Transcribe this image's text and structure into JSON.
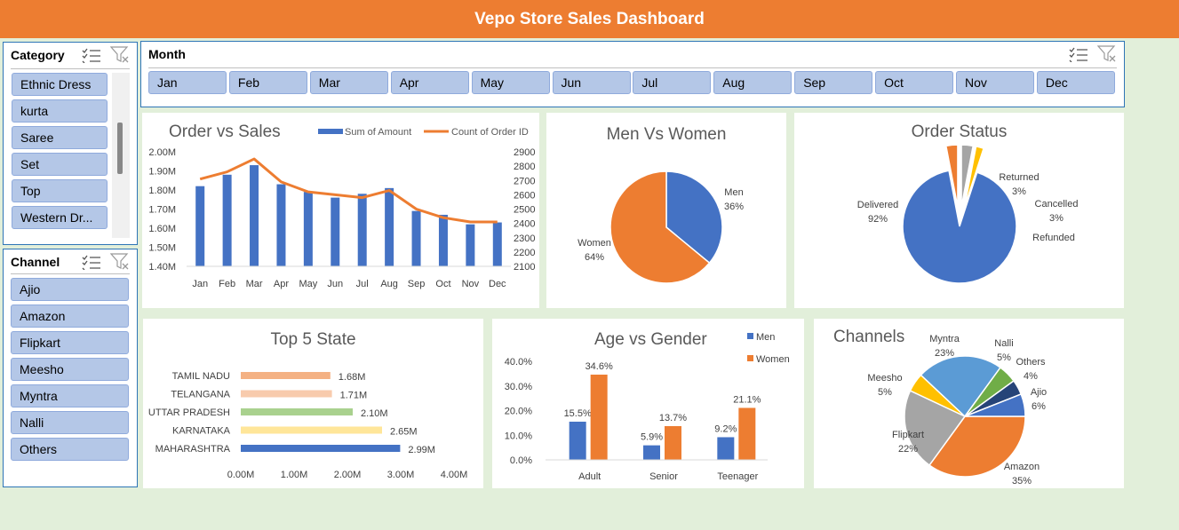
{
  "header": {
    "title": "Vepo Store Sales Dashboard"
  },
  "category_slicer": {
    "title": "Category",
    "items": [
      "Ethnic Dress",
      "kurta",
      "Saree",
      "Set",
      "Top",
      "Western Dr..."
    ]
  },
  "channel_slicer": {
    "title": "Channel",
    "items": [
      "Ajio",
      "Amazon",
      "Flipkart",
      "Meesho",
      "Myntra",
      "Nalli",
      "Others"
    ]
  },
  "month_slicer": {
    "title": "Month",
    "items": [
      "Jan",
      "Feb",
      "Mar",
      "Apr",
      "May",
      "Jun",
      "Jul",
      "Aug",
      "Sep",
      "Oct",
      "Nov",
      "Dec"
    ]
  },
  "colors": {
    "blue": "#4472c4",
    "orange": "#ed7d31",
    "gray": "#a5a5a5",
    "yellow": "#ffc000",
    "light_blue": "#5b9bd5",
    "green": "#70ad47",
    "navy": "#264478"
  },
  "chart_data": [
    {
      "id": "order_vs_sales",
      "type": "bar",
      "title": "Order vs Sales",
      "categories": [
        "Jan",
        "Feb",
        "Mar",
        "Apr",
        "May",
        "Jun",
        "Jul",
        "Aug",
        "Sep",
        "Oct",
        "Nov",
        "Dec"
      ],
      "series": [
        {
          "name": "Sum of Amount",
          "type": "bar",
          "axis": "left",
          "values": [
            1.82,
            1.88,
            1.93,
            1.83,
            1.79,
            1.76,
            1.78,
            1.81,
            1.69,
            1.67,
            1.62,
            1.63
          ]
        },
        {
          "name": "Count of Order ID",
          "type": "line",
          "axis": "right",
          "values": [
            2710,
            2760,
            2850,
            2690,
            2620,
            2600,
            2580,
            2630,
            2500,
            2440,
            2410,
            2410
          ]
        }
      ],
      "ylim": [
        1.4,
        2.0
      ],
      "y_ticks": [
        "1.40M",
        "1.50M",
        "1.60M",
        "1.70M",
        "1.80M",
        "1.90M",
        "2.00M"
      ],
      "y2lim": [
        2100,
        2900
      ],
      "y2_ticks": [
        "2100",
        "2200",
        "2300",
        "2400",
        "2500",
        "2600",
        "2700",
        "2800",
        "2900"
      ],
      "legend": "top"
    },
    {
      "id": "men_vs_women",
      "type": "pie",
      "title": "Men Vs Women",
      "labels": [
        "Men",
        "Women"
      ],
      "values": [
        36,
        64
      ],
      "value_labels": [
        "36%",
        "64%"
      ]
    },
    {
      "id": "order_status",
      "type": "pie",
      "title": "Order Status",
      "labels": [
        "Delivered",
        "Returned",
        "Cancelled",
        "Refunded"
      ],
      "values": [
        92,
        3,
        3,
        2
      ],
      "value_labels": [
        "92%",
        "3%",
        "3%",
        ""
      ]
    },
    {
      "id": "top5_state",
      "type": "bar",
      "orientation": "horizontal",
      "title": "Top 5 State",
      "categories": [
        "TAMIL NADU",
        "TELANGANA",
        "UTTAR PRADESH",
        "KARNATAKA",
        "MAHARASHTRA"
      ],
      "values": [
        1.68,
        1.71,
        2.1,
        2.65,
        2.99
      ],
      "value_labels": [
        "1.68M",
        "1.71M",
        "2.10M",
        "2.65M",
        "2.99M"
      ],
      "xlim": [
        0,
        4
      ],
      "x_ticks": [
        "0.00M",
        "1.00M",
        "2.00M",
        "3.00M",
        "4.00M"
      ]
    },
    {
      "id": "age_vs_gender",
      "type": "bar",
      "title": "Age vs Gender",
      "categories": [
        "Adult",
        "Senior",
        "Teenager"
      ],
      "series": [
        {
          "name": "Men",
          "values": [
            15.5,
            5.9,
            9.2
          ],
          "value_labels": [
            "15.5%",
            "5.9%",
            "9.2%"
          ]
        },
        {
          "name": "Women",
          "values": [
            34.6,
            13.7,
            21.1
          ],
          "value_labels": [
            "34.6%",
            "13.7%",
            "21.1%"
          ]
        }
      ],
      "ylim": [
        0,
        40
      ],
      "y_ticks": [
        "0.0%",
        "10.0%",
        "20.0%",
        "30.0%",
        "40.0%"
      ],
      "legend": "top-right"
    },
    {
      "id": "channels",
      "type": "pie",
      "title": "Channels",
      "labels": [
        "Amazon",
        "Flipkart",
        "Meesho",
        "Myntra",
        "Nalli",
        "Others",
        "Ajio"
      ],
      "values": [
        35,
        22,
        5,
        23,
        5,
        4,
        6
      ],
      "value_labels": [
        "35%",
        "22%",
        "5%",
        "23%",
        "5%",
        "4%",
        "6%"
      ]
    }
  ]
}
